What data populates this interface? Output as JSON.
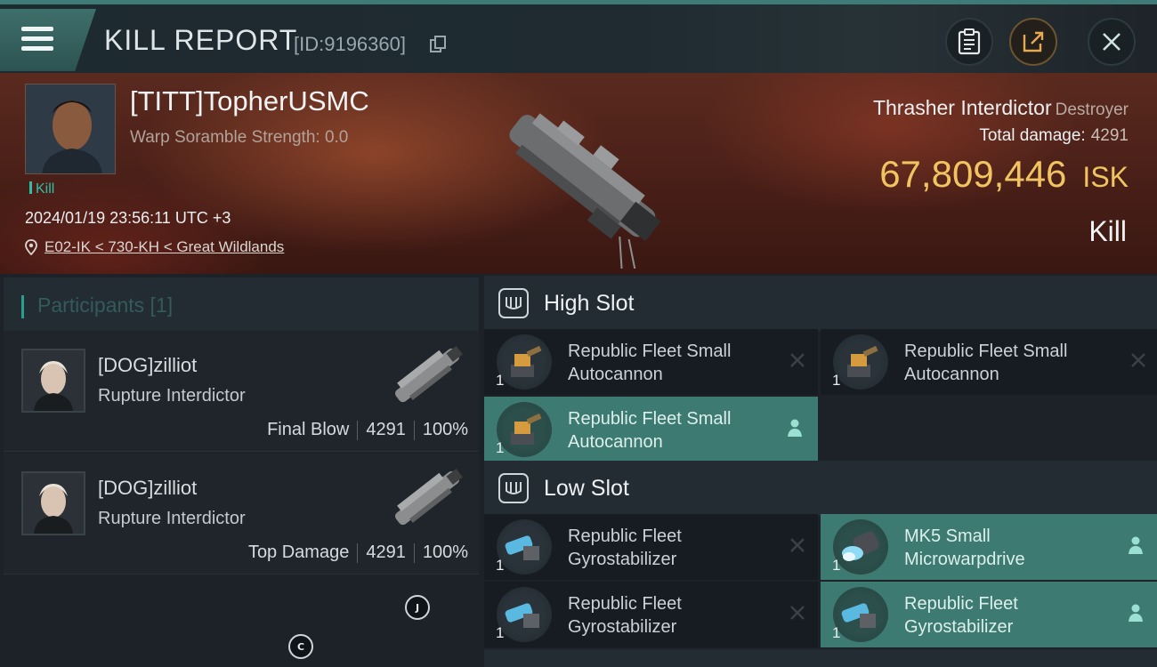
{
  "header": {
    "title": "KILL REPORT",
    "report_id": "[ID:9196360]"
  },
  "victim": {
    "name": "[TITT]TopherUSMC",
    "warp_scramble": "Warp Soramble Strength: 0.0",
    "kill_tag": "Kill",
    "datetime": "2024/01/19 23:56:11 UTC +3",
    "location": "E02-IK < 730-KH < Great Wildlands",
    "ship_name": "Thrasher Interdictor",
    "ship_class": "Destroyer",
    "total_damage_label": "Total damage:",
    "total_damage_value": "4291",
    "isk_amount": "67,809,446",
    "isk_unit": "ISK",
    "result": "Kill"
  },
  "participants": {
    "header": "Participants [1]",
    "items": [
      {
        "name": "[DOG]zilliot",
        "ship": "Rupture Interdictor",
        "role": "Final Blow",
        "damage": "4291",
        "percent": "100%"
      },
      {
        "name": "[DOG]zilliot",
        "ship": "Rupture Interdictor",
        "role": "Top Damage",
        "damage": "4291",
        "percent": "100%"
      }
    ]
  },
  "nav_markers": {
    "j": "J",
    "c": "C"
  },
  "slots": {
    "high": {
      "label": "High Slot",
      "modules": [
        {
          "name": "Republic Fleet Small Autocannon",
          "qty": "1",
          "state": "destroyed"
        },
        {
          "name": "Republic Fleet Small Autocannon",
          "qty": "1",
          "state": "destroyed"
        },
        {
          "name": "Republic Fleet Small Autocannon",
          "qty": "1",
          "state": "dropped"
        }
      ]
    },
    "low": {
      "label": "Low Slot",
      "modules": [
        {
          "name": "Republic Fleet Gyrostabilizer",
          "qty": "1",
          "state": "destroyed"
        },
        {
          "name": "MK5 Small Microwarpdrive",
          "qty": "1",
          "state": "dropped"
        },
        {
          "name": "Republic Fleet Gyrostabilizer",
          "qty": "1",
          "state": "destroyed"
        },
        {
          "name": "Republic Fleet Gyrostabilizer",
          "qty": "1",
          "state": "dropped"
        }
      ]
    }
  },
  "colors": {
    "accent_teal": "#3d7a72",
    "isk_gold": "#f1c462",
    "kill_green": "#2fbfa6"
  }
}
